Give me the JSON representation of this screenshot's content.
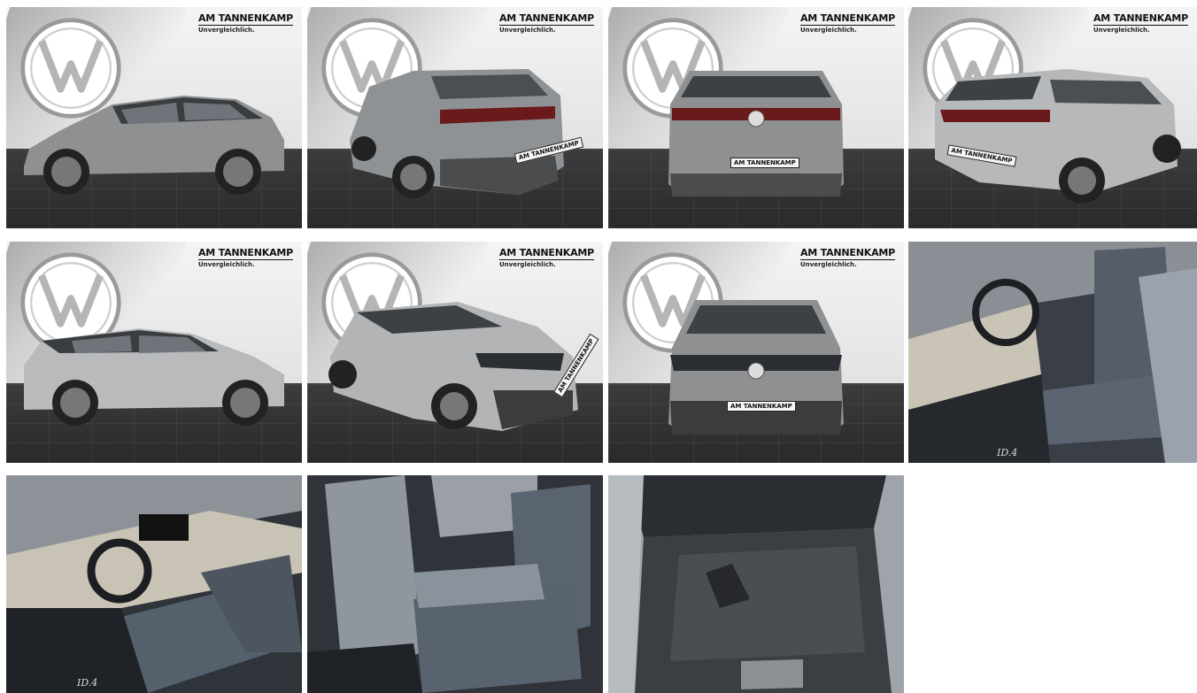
{
  "gallery": {
    "dealer": {
      "name": "AM TANNENKAMP",
      "tagline": "Unvergleichlich."
    },
    "plate_text": "AM TANNENKAMP",
    "badge_text": "ID.4",
    "colors": {
      "car_body": "#8e9092",
      "car_dark": "#3a3d40",
      "floor": "#2e2e30",
      "wall": "#ececec",
      "interior_fabric": "#5b6470"
    },
    "images": [
      {
        "view": "side-left"
      },
      {
        "view": "rear-left-three-quarter"
      },
      {
        "view": "rear"
      },
      {
        "view": "rear-right-three-quarter"
      },
      {
        "view": "side-right"
      },
      {
        "view": "front-right-three-quarter"
      },
      {
        "view": "front"
      },
      {
        "view": "interior-driver-seat"
      },
      {
        "view": "interior-dashboard"
      },
      {
        "view": "interior-rear-seats"
      },
      {
        "view": "trunk"
      }
    ]
  }
}
